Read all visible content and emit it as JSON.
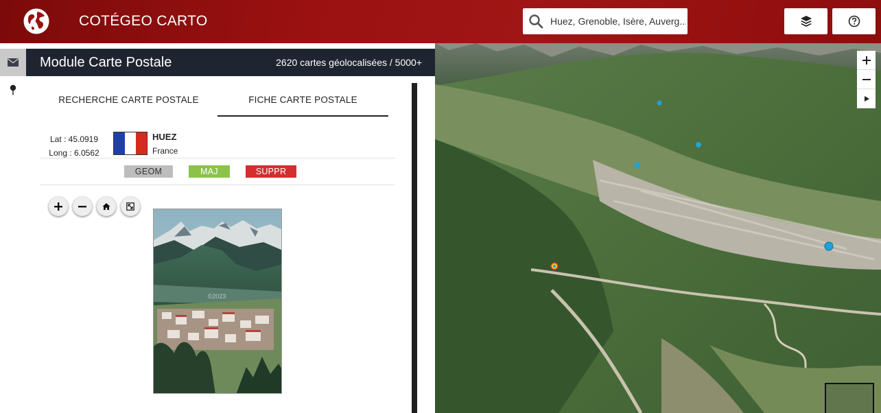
{
  "header": {
    "app_title": "COTÉGEO CARTO",
    "search_value": "Huez, Grenoble, Isère, Auverg...",
    "layers_icon": "layers-icon",
    "help_icon": "help-icon"
  },
  "rail": {
    "items": [
      {
        "icon": "envelope-icon"
      },
      {
        "icon": "map-pin-icon"
      }
    ]
  },
  "panel": {
    "title": "Module Carte Postale",
    "count": "2620 cartes géolocalisées / 5000+",
    "tabs": [
      {
        "label": "RECHERCHE CARTE POSTALE"
      },
      {
        "label": "FICHE CARTE POSTALE"
      }
    ],
    "record": {
      "lat": "Lat : 45.0919",
      "long": "Long : 6.0562",
      "place": "HUEZ",
      "country": "France"
    },
    "actions": {
      "geom": "GEOM",
      "maj": "MAJ",
      "suppr": "SUPPR"
    },
    "viewer": {
      "controls": [
        "zoom-in-icon",
        "zoom-out-icon",
        "home-icon",
        "fullscreen-icon"
      ]
    },
    "postcard": {
      "watermark": "©2023"
    }
  },
  "map": {
    "controls": [
      "zoom-in-icon",
      "zoom-out-icon",
      "play-icon"
    ]
  },
  "colors": {
    "header": "#9b1111",
    "panel_header": "#1f2530",
    "geom": "#bdbdbd",
    "maj": "#8bc34a",
    "suppr": "#d32f2f",
    "map_marker": "#1fa3d8"
  }
}
